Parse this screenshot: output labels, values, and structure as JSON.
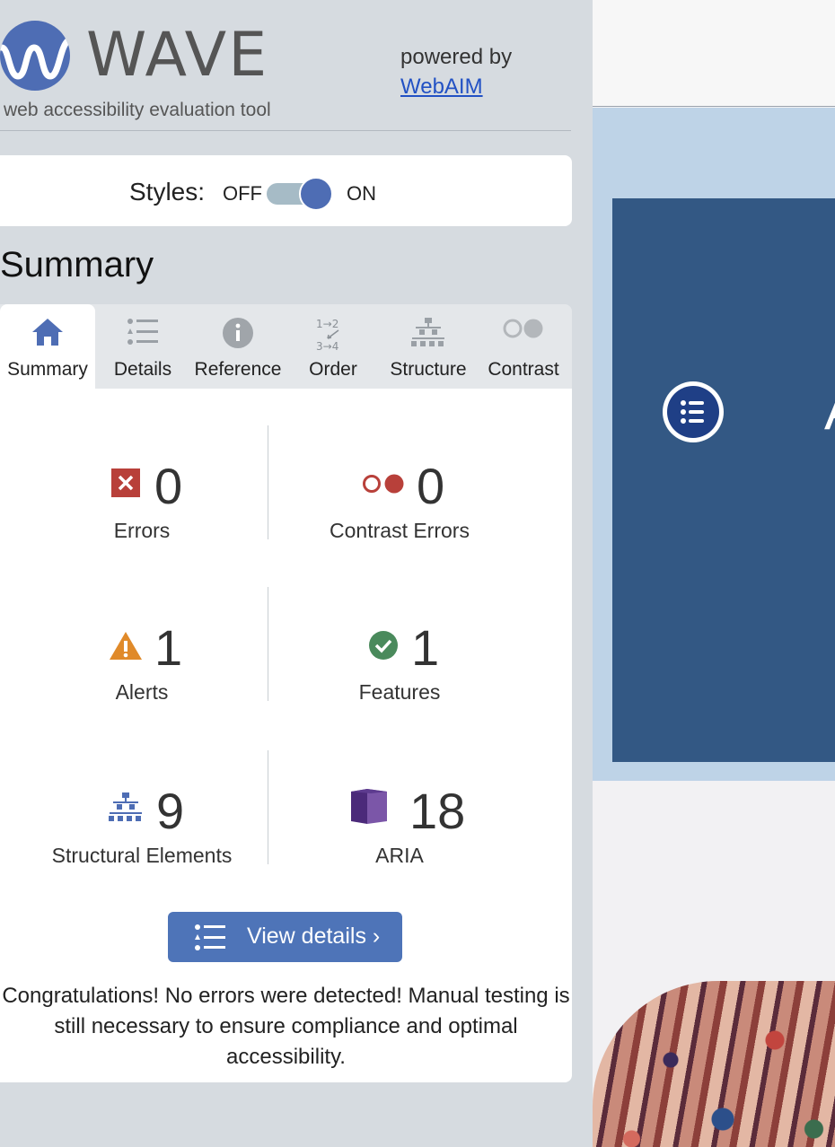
{
  "header": {
    "logo_word": "WAVE",
    "logo_subtitle": "web accessibility evaluation tool",
    "powered_by": "powered by",
    "webaim_link": "WebAIM"
  },
  "styles_toggle": {
    "label": "Styles:",
    "off_label": "OFF",
    "on_label": "ON",
    "state": "on"
  },
  "summary_heading": "Summary",
  "tabs": [
    {
      "label": "Summary",
      "icon": "home-icon",
      "active": true
    },
    {
      "label": "Details",
      "icon": "list-icon",
      "active": false
    },
    {
      "label": "Reference",
      "icon": "info-icon",
      "active": false
    },
    {
      "label": "Order",
      "icon": "order-icon",
      "active": false
    },
    {
      "label": "Structure",
      "icon": "structure-icon",
      "active": false
    },
    {
      "label": "Contrast",
      "icon": "contrast-icon",
      "active": false
    }
  ],
  "stats": {
    "errors": {
      "count": "0",
      "label": "Errors",
      "icon": "error-x-icon",
      "color": "#b8403a"
    },
    "contrast_errors": {
      "count": "0",
      "label": "Contrast Errors",
      "icon": "contrast-error-icon",
      "color": "#b8403a"
    },
    "alerts": {
      "count": "1",
      "label": "Alerts",
      "icon": "alert-triangle-icon",
      "color": "#e08a2a"
    },
    "features": {
      "count": "1",
      "label": "Features",
      "icon": "feature-check-icon",
      "color": "#4a8a5c"
    },
    "structural": {
      "count": "9",
      "label": "Structural Elements",
      "icon": "structure-tree-icon",
      "color": "#4e6db4"
    },
    "aria": {
      "count": "18",
      "label": "ARIA",
      "icon": "aria-cube-icon",
      "color": "#4b2a7a"
    }
  },
  "view_details_button": "View details ›",
  "congrats_message": "Congratulations! No errors were detected! Manual testing is still necessary to ensure compliance and optimal accessibility.",
  "page_preview": {
    "hero_icon": "list-circle-icon",
    "hero_edge_glyph": "A"
  },
  "colors": {
    "accent": "#4e6db4",
    "sidebar_bg": "#d6dbe0",
    "hero_bg": "#335884",
    "band_bg": "#bed3e7"
  }
}
